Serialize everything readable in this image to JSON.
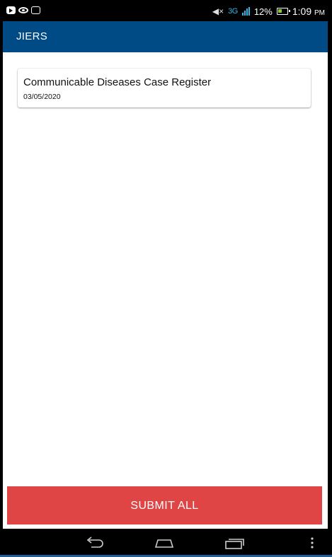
{
  "status_bar": {
    "network": "3G",
    "battery": "12%",
    "time": "1:09",
    "time_suffix": "PM"
  },
  "toolbar": {
    "title": "JIERS"
  },
  "records": [
    {
      "title": "Communicable Diseases Case Register",
      "date": "03/05/2020"
    }
  ],
  "actions": {
    "submit_all_label": "SUBMIT ALL"
  },
  "colors": {
    "toolbar": "#004a85",
    "submit_button": "#e04545",
    "status_accent": "#33b5e5"
  },
  "icons": {
    "status_left": [
      "youtube-icon",
      "eye-icon",
      "media-icon"
    ],
    "status_right": [
      "mute-icon",
      "signal-icon",
      "battery-icon"
    ],
    "nav": [
      "back-icon",
      "home-icon",
      "recents-icon",
      "menu-icon"
    ]
  }
}
